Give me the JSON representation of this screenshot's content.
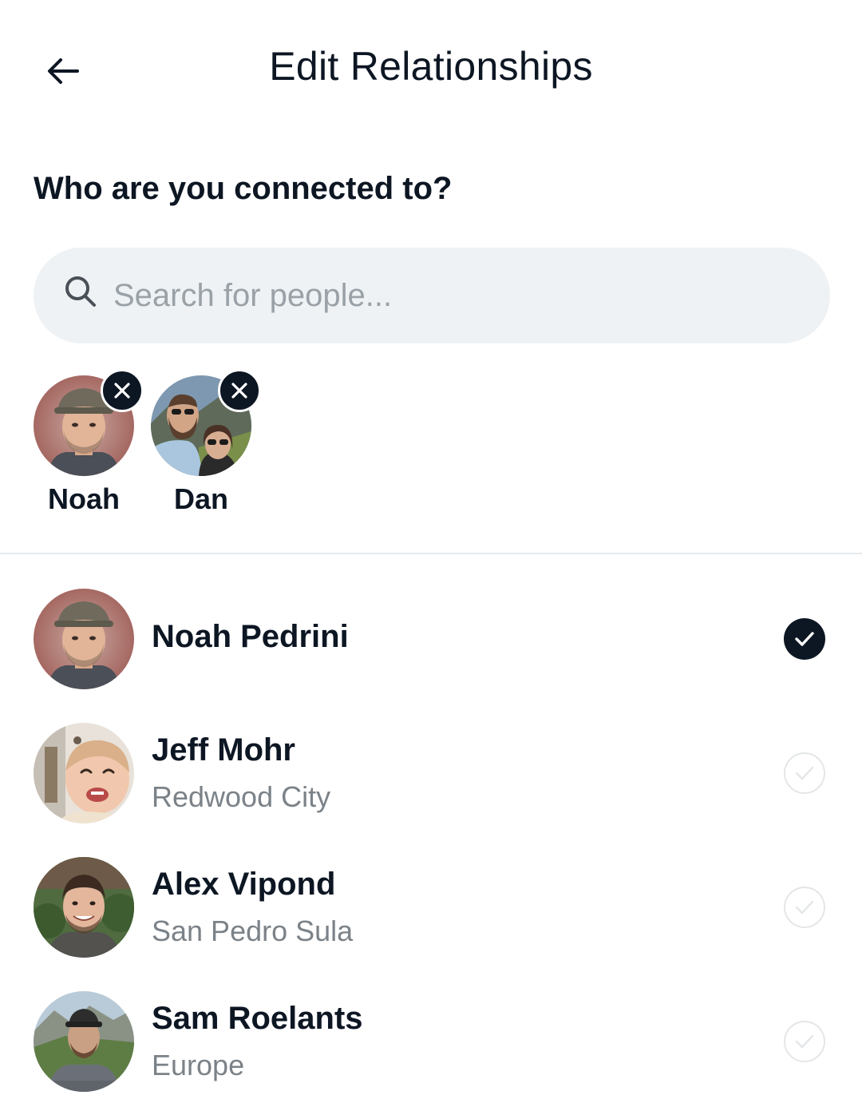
{
  "header": {
    "title": "Edit Relationships",
    "back_icon": "arrow-left-icon"
  },
  "prompt": "Who are you connected to?",
  "search": {
    "placeholder": "Search for people...",
    "value": "",
    "icon": "search-icon"
  },
  "selected": [
    {
      "label": "Noah"
    },
    {
      "label": "Dan"
    }
  ],
  "people": [
    {
      "name": "Noah Pedrini",
      "location": "",
      "selected": true
    },
    {
      "name": "Jeff Mohr",
      "location": "Redwood City",
      "selected": false
    },
    {
      "name": "Alex Vipond",
      "location": "San Pedro Sula",
      "selected": false
    },
    {
      "name": "Sam Roelants",
      "location": "Europe",
      "selected": false
    }
  ],
  "colors": {
    "primary": "#0d1623",
    "search_bg": "#eef2f4",
    "muted_text": "#7b8288",
    "placeholder": "#9aa1a7",
    "divider": "#e7eaec"
  }
}
